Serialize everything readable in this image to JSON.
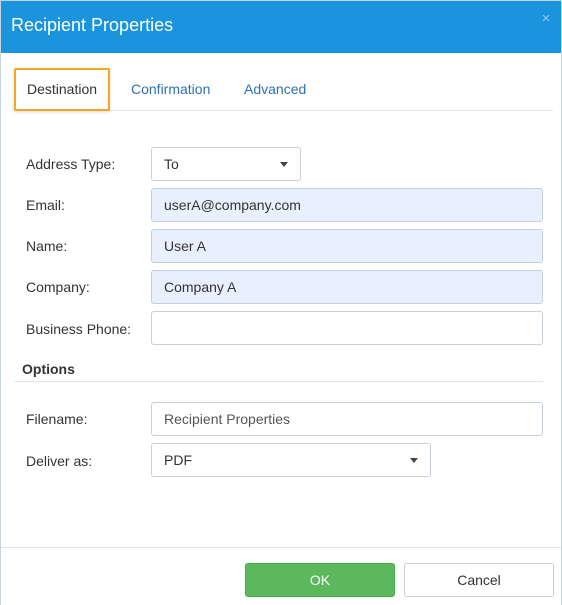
{
  "window": {
    "title": "Recipient Properties",
    "close_glyph": "×"
  },
  "tabs": [
    {
      "label": "Destination",
      "active": true
    },
    {
      "label": "Confirmation",
      "active": false
    },
    {
      "label": "Advanced",
      "active": false
    }
  ],
  "form": {
    "address_type": {
      "label": "Address Type:",
      "value": "To"
    },
    "email": {
      "label": "Email:",
      "value": "userA@company.com"
    },
    "name": {
      "label": "Name:",
      "value": "User A"
    },
    "company": {
      "label": "Company:",
      "value": "Company A"
    },
    "business_phone": {
      "label": "Business Phone:",
      "value": ""
    }
  },
  "options": {
    "title": "Options",
    "filename": {
      "label": "Filename:",
      "placeholder": "Recipient Properties"
    },
    "deliver_as": {
      "label": "Deliver as:",
      "value": "PDF"
    }
  },
  "footer": {
    "ok_label": "OK",
    "cancel_label": "Cancel"
  },
  "colors": {
    "titlebar": "#1a94dc",
    "active_tab_outline": "#f5a623",
    "ok_button": "#5cb85c",
    "autofill_background": "#e8f0fe",
    "link": "#2f6fb3"
  },
  "icons": {
    "close": "close-icon",
    "dropdown": "caret-down-icon"
  }
}
